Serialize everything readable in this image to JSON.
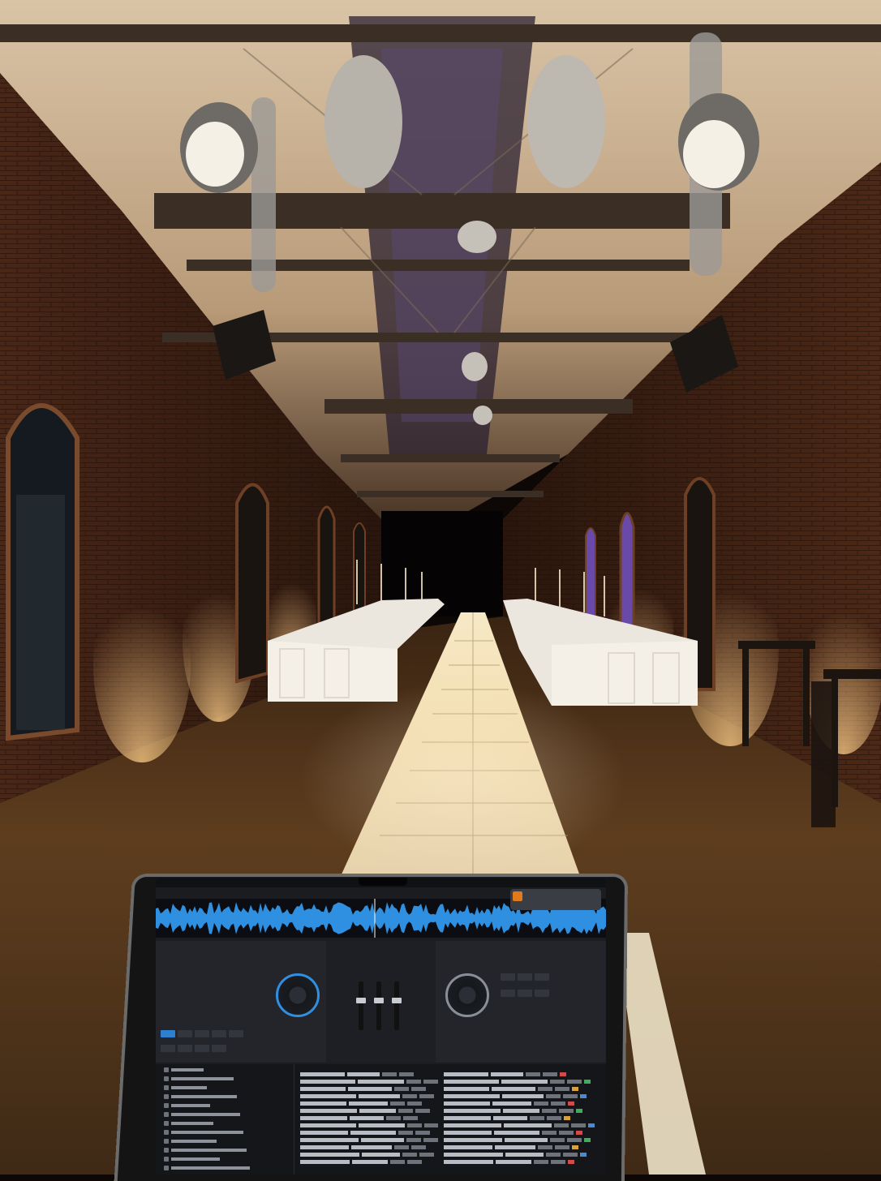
{
  "scene": {
    "description_tag": "photo",
    "colors": {
      "brick": "#6a3a22",
      "brick_dark": "#2e1810",
      "ceiling": "#e8d6bf",
      "floor": "#5a3a1c",
      "runway": "#f2e2bc",
      "uplight": "#ffcf8a",
      "purple_window": "#6a4aa8",
      "steel": "#3b2e24"
    }
  },
  "laptop": {
    "app_colors": {
      "accent": "#2f8fe0",
      "notification_icon": "#e07a1a"
    }
  }
}
